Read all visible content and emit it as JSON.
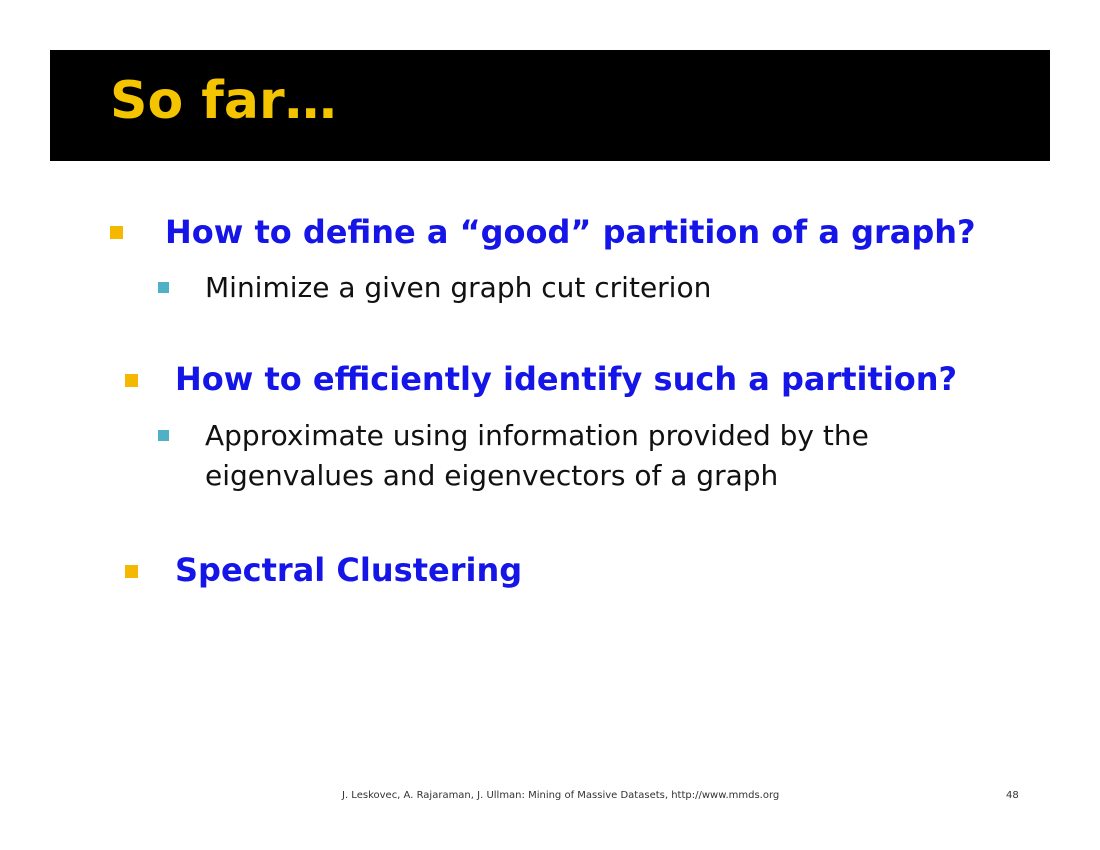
{
  "slide": {
    "title": "So far…",
    "colors": {
      "title_bar": "#000000",
      "title_text": "#f5c400",
      "level1_bullet": "#f5b800",
      "level2_bullet": "#4fb0c6",
      "level1_text": "#1515e8",
      "level2_text": "#111111"
    },
    "items": [
      {
        "text": "How to define a “good” partition of a graph?",
        "subitems": [
          "Minimize a given graph cut criterion"
        ]
      },
      {
        "text": "How to efficiently identify such a partition?",
        "subitems": [
          "Approximate using information provided by the eigenvalues and eigenvectors of a graph"
        ]
      },
      {
        "text": "Spectral Clustering",
        "subitems": []
      }
    ],
    "footer": {
      "citation": "J. Leskovec, A. Rajaraman, J. Ullman: Mining of Massive Datasets, http://www.mmds.org",
      "page_number": "48"
    }
  }
}
